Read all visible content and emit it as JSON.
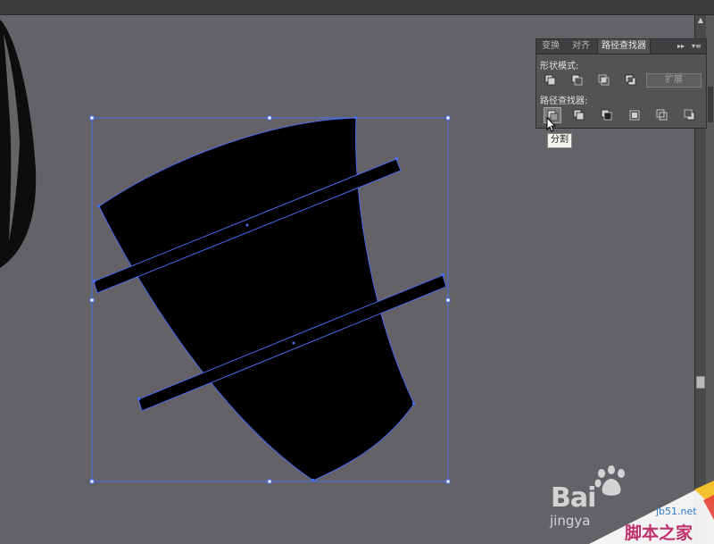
{
  "panel": {
    "tabs": [
      "变换",
      "对齐",
      "路径查找器"
    ],
    "active_tab": "路径查找器",
    "tab_menu_glyphs": [
      "▸▸",
      "▾≡"
    ],
    "shape_modes_label": "形状模式:",
    "pathfinders_label": "路径查找器:",
    "expand_label": "扩展"
  },
  "tooltip": {
    "text": "分割"
  },
  "watermark": {
    "baidu": "Bai",
    "jingyan": "jingya",
    "site": "jb51.net",
    "site_cn": "脚本之家"
  },
  "colors": {
    "canvas": "#646266",
    "selection": "#4a6cf0",
    "panel": "#535254",
    "shape_fill": "#000000"
  },
  "icons": {
    "shape_mode_buttons": [
      "unite-icon",
      "minus-front-icon",
      "intersect-icon",
      "exclude-icon"
    ],
    "pathfinder_buttons": [
      "divide-icon",
      "trim-icon",
      "merge-icon",
      "crop-icon",
      "outline-icon",
      "minus-back-icon"
    ],
    "pressed_button": "divide-icon"
  }
}
